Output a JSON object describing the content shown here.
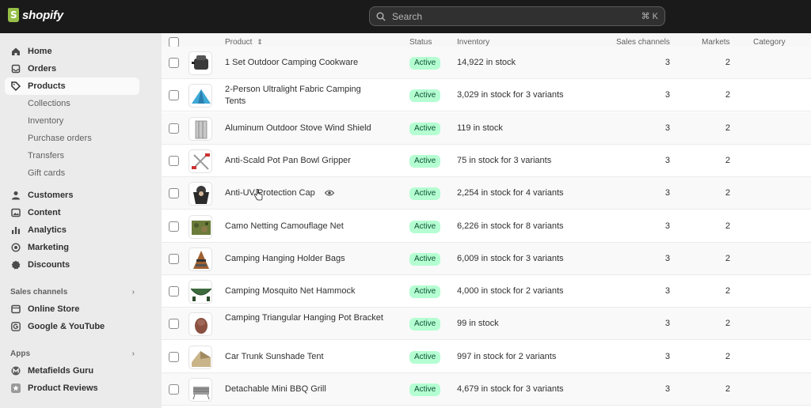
{
  "app": {
    "logo_text": "shopify"
  },
  "search": {
    "placeholder": "Search",
    "shortcut": "⌘ K"
  },
  "sidebar": {
    "items": [
      {
        "label": "Home",
        "icon": "home-icon"
      },
      {
        "label": "Orders",
        "icon": "orders-icon"
      },
      {
        "label": "Products",
        "icon": "tag-icon",
        "active": true
      }
    ],
    "product_sub": [
      "Collections",
      "Inventory",
      "Purchase orders",
      "Transfers",
      "Gift cards"
    ],
    "items2": [
      {
        "label": "Customers",
        "icon": "person-icon"
      },
      {
        "label": "Content",
        "icon": "content-icon"
      },
      {
        "label": "Analytics",
        "icon": "analytics-icon"
      },
      {
        "label": "Marketing",
        "icon": "marketing-icon"
      },
      {
        "label": "Discounts",
        "icon": "discount-icon"
      }
    ],
    "sales_channels_label": "Sales channels",
    "sales_channels": [
      {
        "label": "Online Store",
        "icon": "store-icon"
      },
      {
        "label": "Google & YouTube",
        "icon": "google-icon"
      }
    ],
    "apps_label": "Apps",
    "apps": [
      {
        "label": "Metafields Guru",
        "icon": "metafields-icon"
      },
      {
        "label": "Product Reviews",
        "icon": "star-icon"
      }
    ]
  },
  "table": {
    "headers": {
      "product": "Product",
      "status": "Status",
      "inventory": "Inventory",
      "sales_channels": "Sales channels",
      "markets": "Markets",
      "category": "Category"
    },
    "rows": [
      {
        "name": "1 Set Outdoor Camping Cookware",
        "status": "Active",
        "inventory": "14,922 in stock",
        "channels": "3",
        "markets": "2",
        "thumb": "cookware"
      },
      {
        "name": "2-Person Ultralight Fabric Camping Tents",
        "status": "Active",
        "inventory": "3,029 in stock for 3 variants",
        "channels": "3",
        "markets": "2",
        "thumb": "tent"
      },
      {
        "name": "Aluminum Outdoor Stove Wind Shield",
        "status": "Active",
        "inventory": "119 in stock",
        "channels": "3",
        "markets": "2",
        "thumb": "shield"
      },
      {
        "name": "Anti-Scald Pot Pan Bowl Gripper",
        "status": "Active",
        "inventory": "75 in stock for 3 variants",
        "channels": "3",
        "markets": "2",
        "thumb": "gripper"
      },
      {
        "name": "Anti-UV Protection Cap",
        "status": "Active",
        "inventory": "2,254 in stock for 4 variants",
        "channels": "3",
        "markets": "2",
        "thumb": "cap"
      },
      {
        "name": "Camo Netting Camouflage Net",
        "status": "Active",
        "inventory": "6,226 in stock for 8 variants",
        "channels": "3",
        "markets": "2",
        "thumb": "camo"
      },
      {
        "name": "Camping Hanging Holder Bags",
        "status": "Active",
        "inventory": "6,009 in stock for 3 variants",
        "channels": "3",
        "markets": "2",
        "thumb": "bags"
      },
      {
        "name": "Camping Mosquito Net Hammock",
        "status": "Active",
        "inventory": "4,000 in stock for 2 variants",
        "channels": "3",
        "markets": "2",
        "thumb": "hammock"
      },
      {
        "name": "Camping Triangular Hanging Pot Bracket",
        "status": "Active",
        "inventory": "99 in stock",
        "channels": "3",
        "markets": "2",
        "thumb": "pot"
      },
      {
        "name": "Car Trunk Sunshade Tent",
        "status": "Active",
        "inventory": "997 in stock for 2 variants",
        "channels": "3",
        "markets": "2",
        "thumb": "sunshade"
      },
      {
        "name": "Detachable Mini BBQ Grill",
        "status": "Active",
        "inventory": "4,679 in stock for 3 variants",
        "channels": "3",
        "markets": "2",
        "thumb": "grill"
      }
    ]
  },
  "colors": {
    "badge_bg": "#b4fed2",
    "badge_text": "#0c5132",
    "topbar": "#1a1a1a",
    "logo": "#95bf47"
  }
}
